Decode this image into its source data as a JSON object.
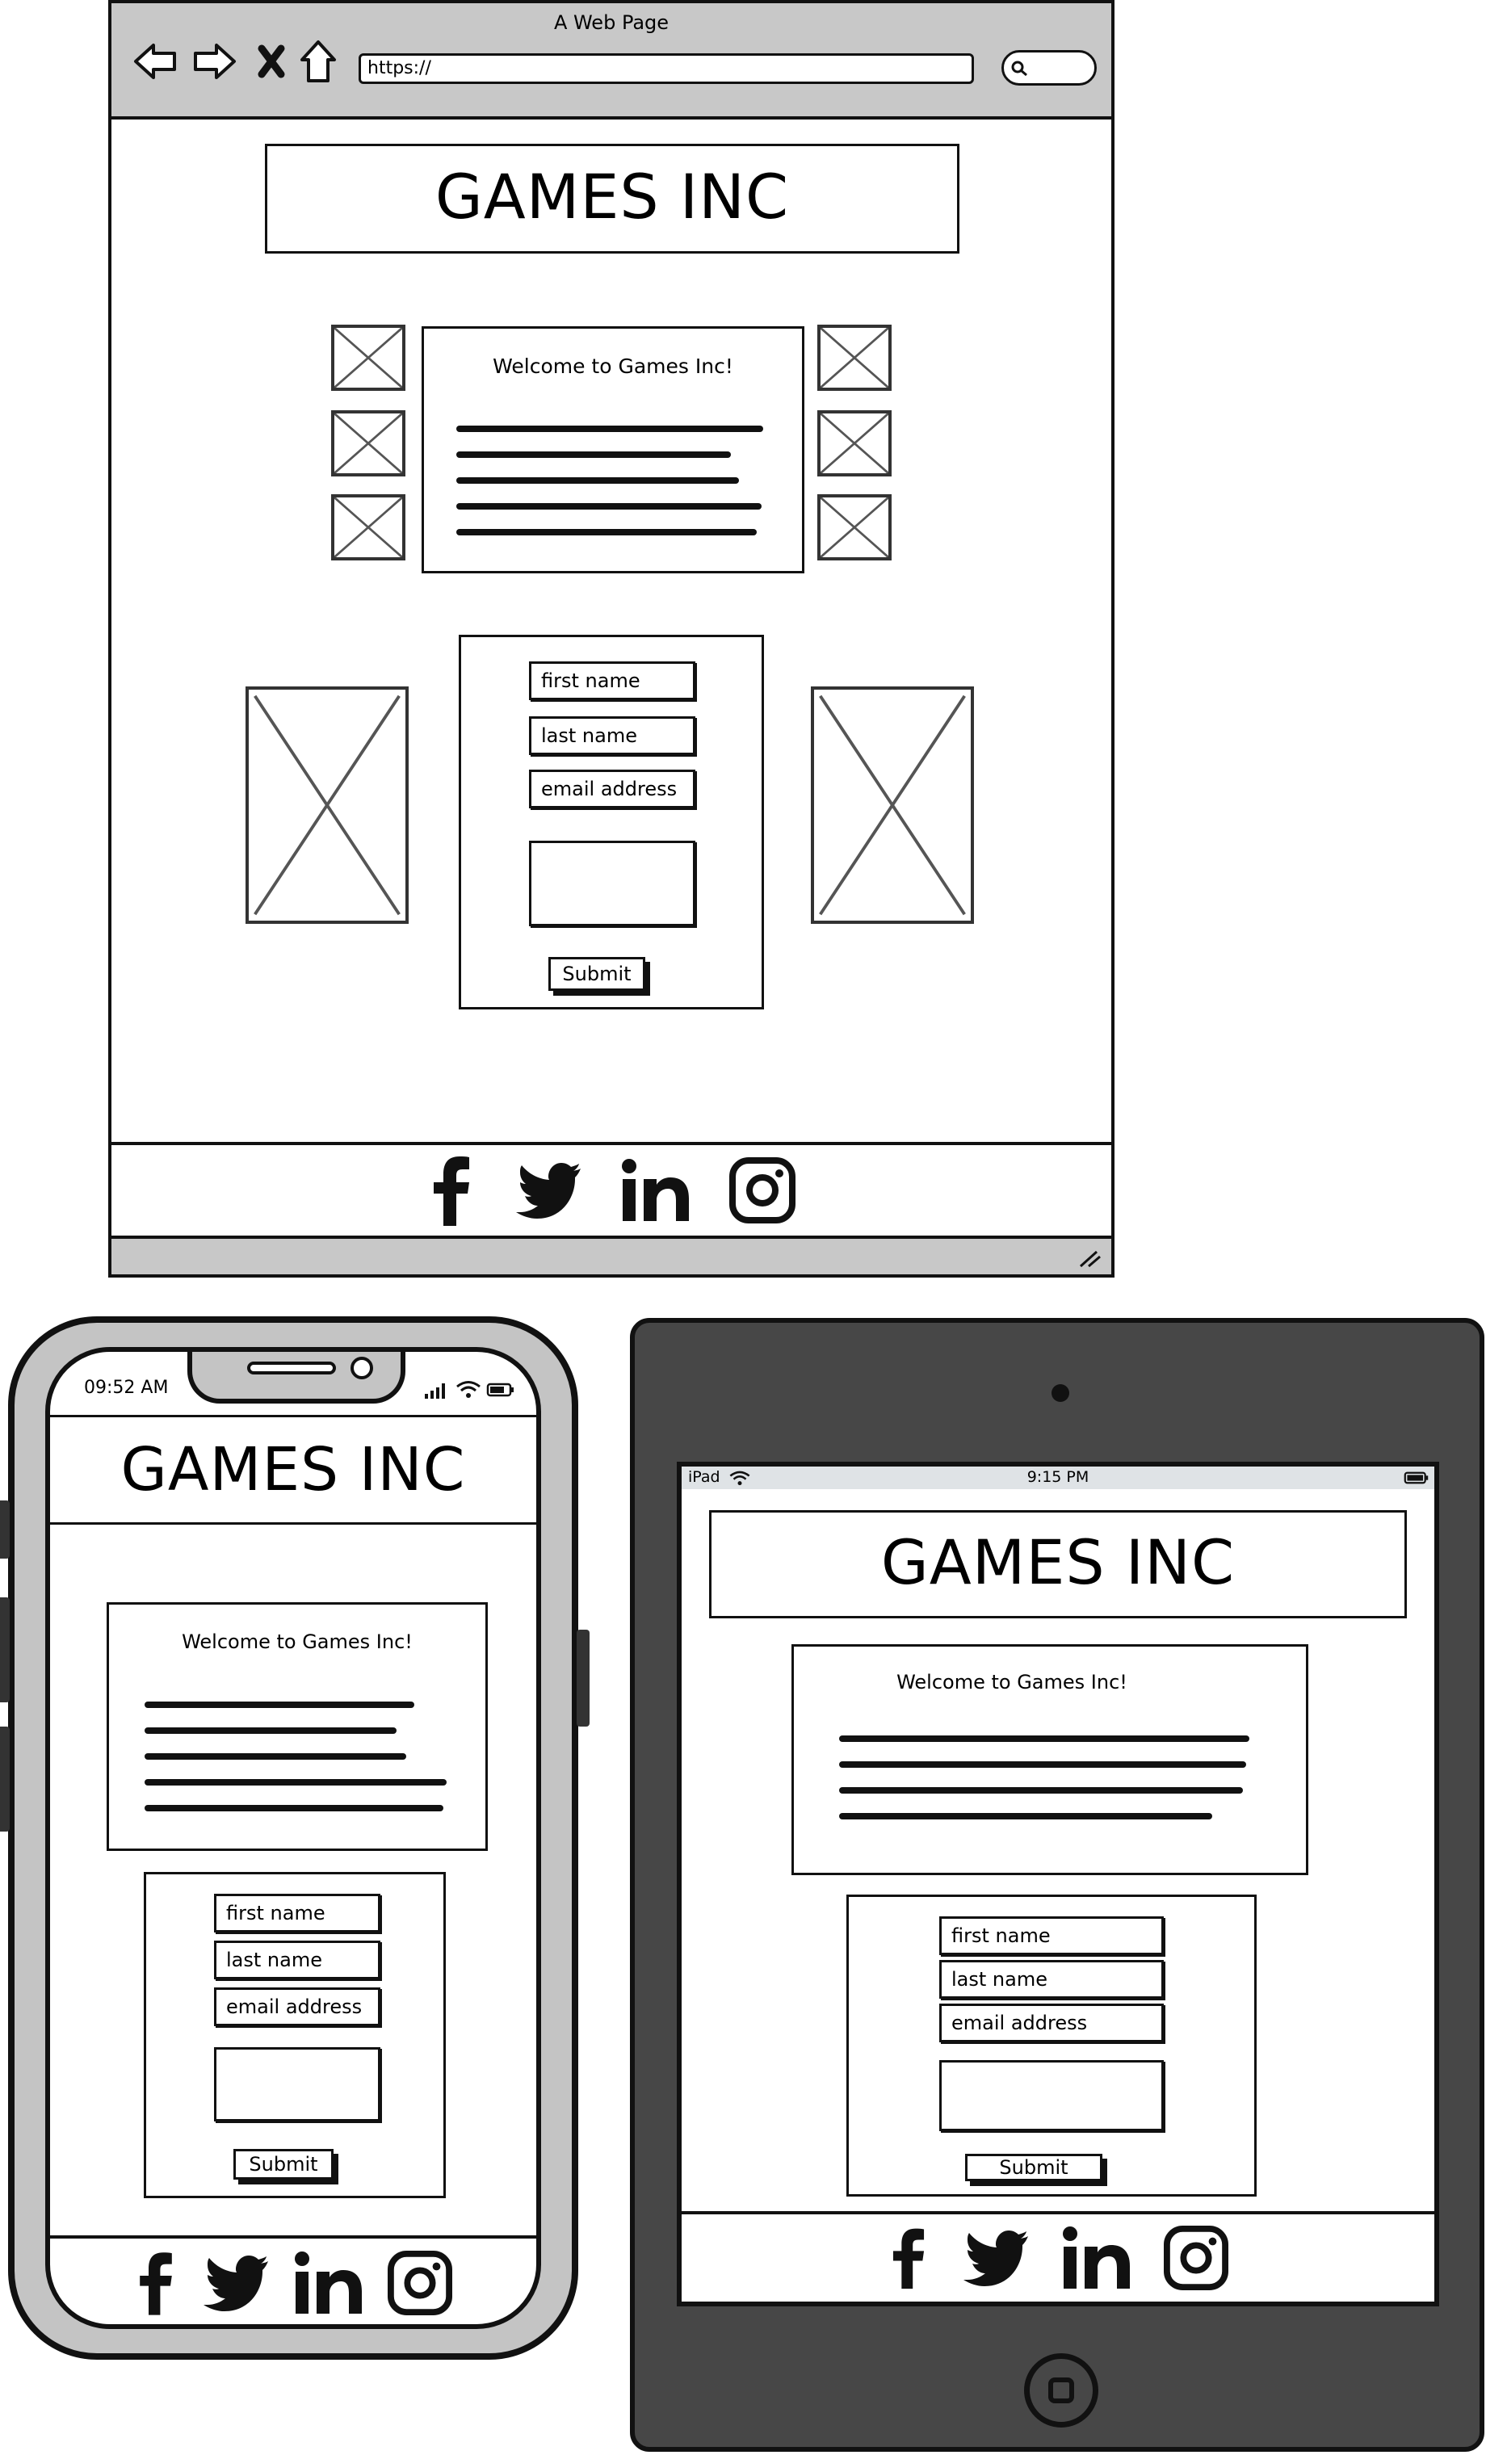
{
  "browser": {
    "title": "A Web Page",
    "url": "https://"
  },
  "brand": "GAMES INC",
  "welcome": "Welcome to Games Inc!",
  "form": {
    "first_name": "first name",
    "last_name": "last name",
    "email": "email address",
    "submit": "Submit"
  },
  "phone": {
    "time": "09:52 AM"
  },
  "tablet": {
    "device": "iPad",
    "time": "9:15 PM"
  },
  "social_icons": [
    "facebook-icon",
    "twitter-icon",
    "linkedin-icon",
    "instagram-icon"
  ],
  "colors": {
    "chrome_gray": "#c8c8c8",
    "tablet_body": "#474747",
    "phone_frame": "#c4c4c4",
    "tablet_status": "#dfe3e6"
  }
}
